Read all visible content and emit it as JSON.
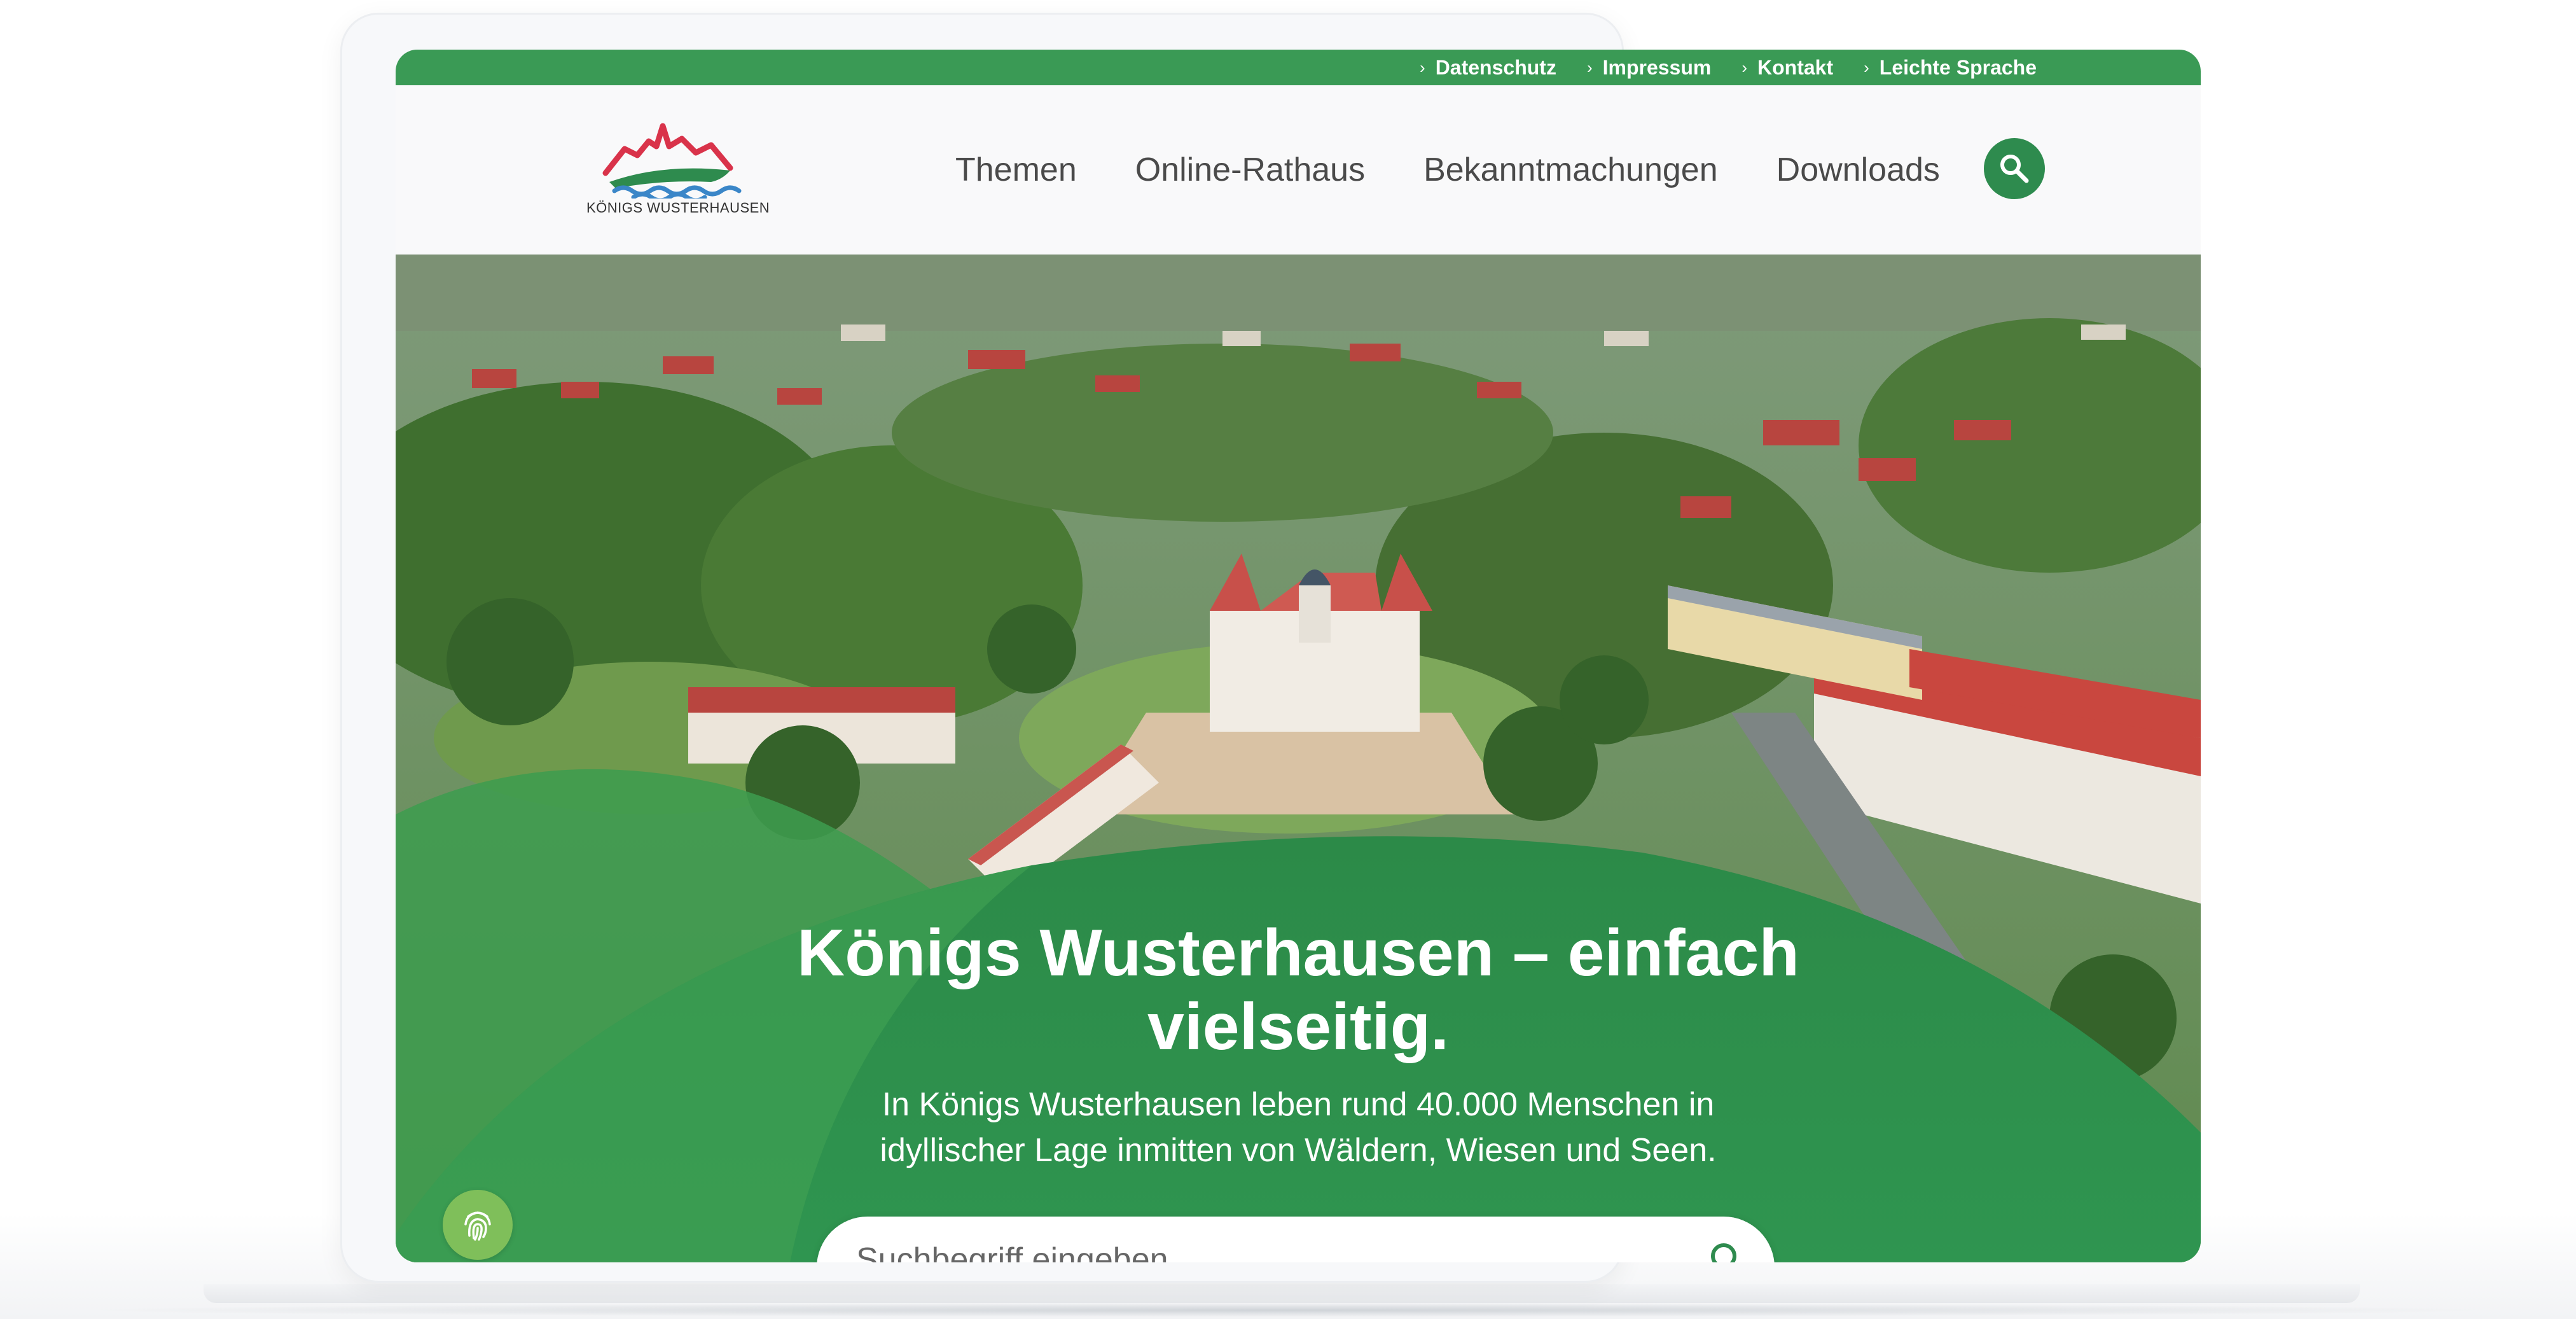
{
  "utility_bar": {
    "links": [
      {
        "label": "Datenschutz"
      },
      {
        "label": "Impressum"
      },
      {
        "label": "Kontakt"
      },
      {
        "label": "Leichte Sprache"
      }
    ]
  },
  "header": {
    "logo_text": "KÖNIGS WUSTERHAUSEN",
    "nav": [
      {
        "label": "Themen"
      },
      {
        "label": "Online-Rathaus"
      },
      {
        "label": "Bekanntmachungen"
      },
      {
        "label": "Downloads"
      }
    ],
    "search_icon": "search-icon"
  },
  "hero": {
    "title_line1": "Königs Wusterhausen – einfach",
    "title_line2": "vielseitig.",
    "subtitle_line1": "In Königs Wusterhausen leben rund 40.000 Menschen in",
    "subtitle_line2": "idyllischer Lage inmitten von Wäldern, Wiesen und Seen.",
    "search_placeholder": "Suchbegriff eingeben",
    "accessibility_icon": "fingerprint-icon"
  },
  "colors": {
    "brand_green": "#3a9a55",
    "button_green": "#2e8b4e",
    "hero_green": "#2a8a46",
    "accessibility_green": "#7fbf5a"
  }
}
